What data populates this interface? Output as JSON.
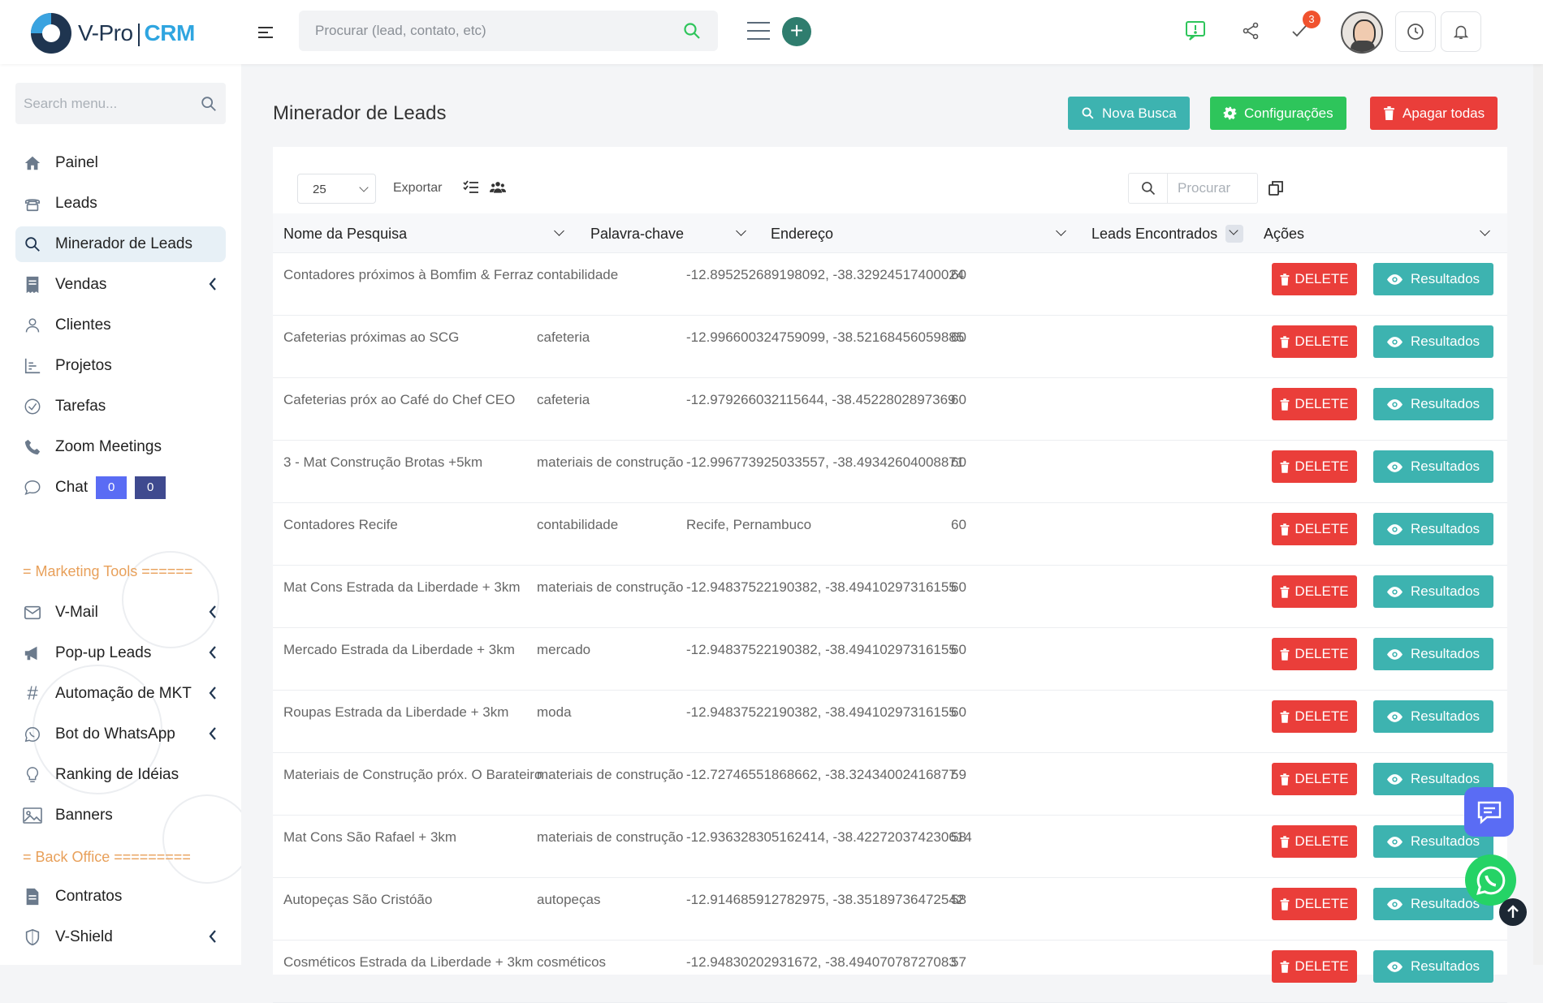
{
  "app": {
    "logo_primary": "V-Pro",
    "logo_secondary": "CRM",
    "notification_count": "3"
  },
  "colors": {
    "accent_teal": "#3db3b0",
    "success_green": "#2ec55b",
    "danger_red": "#ea3e3a",
    "brand_dark": "#1f3550"
  },
  "header": {
    "search_placeholder": "Procurar (lead, contato, etc)",
    "icons": [
      "menu-toggle-icon",
      "search-icon",
      "list-icon",
      "plus-icon",
      "feedback-icon",
      "share-icon",
      "check-icon",
      "avatar",
      "clock-icon",
      "bell-icon"
    ]
  },
  "sidebar": {
    "search_placeholder": "Search menu...",
    "items": [
      {
        "label": "Painel",
        "icon": "home-icon"
      },
      {
        "label": "Leads",
        "icon": "phone-desk-icon"
      },
      {
        "label": "Minerador de Leads",
        "icon": "search-icon",
        "active": true
      },
      {
        "label": "Vendas",
        "icon": "receipt-icon"
      },
      {
        "label": "Clientes",
        "icon": "user-icon"
      },
      {
        "label": "Projetos",
        "icon": "chart-icon"
      },
      {
        "label": "Tarefas",
        "icon": "check-circle-icon"
      },
      {
        "label": "Zoom Meetings",
        "icon": "phone-icon"
      },
      {
        "label": "Chat",
        "icon": "chat-bubble-icon"
      }
    ],
    "chat_badges": [
      "0",
      "0"
    ],
    "section_marketing": "= Marketing Tools ======",
    "marketing_items": [
      {
        "label": "V-Mail",
        "icon": "mail-icon"
      },
      {
        "label": "Pop-up Leads",
        "icon": "megaphone-icon"
      },
      {
        "label": "Automação de MKT",
        "icon": "hash-icon"
      },
      {
        "label": "Bot do WhatsApp",
        "icon": "whatsapp-icon"
      },
      {
        "label": "Ranking de Idéias",
        "icon": "lightbulb-icon"
      },
      {
        "label": "Banners",
        "icon": "image-icon"
      }
    ],
    "section_backoffice": "= Back Office =========",
    "backoffice_items": [
      {
        "label": "Contratos",
        "icon": "document-icon"
      },
      {
        "label": "V-Shield",
        "icon": "shield-icon"
      }
    ]
  },
  "page": {
    "title": "Minerador de Leads",
    "buttons": {
      "nova_busca": "Nova Busca",
      "configuracoes": "Configurações",
      "apagar_todas": "Apagar todas"
    },
    "toolbar": {
      "page_size": "25",
      "export": "Exportar",
      "search_placeholder": "Procurar"
    },
    "columns": [
      "Nome da Pesquisa",
      "Palavra-chave",
      "Endereço",
      "Leads Encontrados",
      "Ações"
    ],
    "action_labels": {
      "delete": "DELETE",
      "results": "Resultados"
    },
    "rows": [
      {
        "nome": "Contadores próximos à Bomfim & Ferraz",
        "palavra": "contabilidade",
        "endereco": "-12.895252689198092, -38.32924517400024",
        "leads": "60"
      },
      {
        "nome": "Cafeterias próximas ao SCG",
        "palavra": "cafeteria",
        "endereco": "-12.996600324759099, -38.52168456059885",
        "leads": "60"
      },
      {
        "nome": "Cafeterias próx ao Café do Chef CEO",
        "palavra": "cafeteria",
        "endereco": "-12.979266032115644, -38.4522802897369",
        "leads": "60"
      },
      {
        "nome": "3 - Mat Construção Brotas +5km",
        "palavra": "materiais de construção",
        "endereco": "-12.996773925033557, -38.49342604008871",
        "leads": "60"
      },
      {
        "nome": "Contadores Recife",
        "palavra": "contabilidade",
        "endereco": "Recife, Pernambuco",
        "leads": "60"
      },
      {
        "nome": "Mat Cons Estrada da Liberdade + 3km",
        "palavra": "materiais de construção",
        "endereco": "-12.94837522190382, -38.49410297316155",
        "leads": "60"
      },
      {
        "nome": "Mercado Estrada da Liberdade + 3km",
        "palavra": "mercado",
        "endereco": "-12.94837522190382, -38.49410297316155",
        "leads": "60"
      },
      {
        "nome": "Roupas Estrada da Liberdade + 3km",
        "palavra": "moda",
        "endereco": "-12.94837522190382, -38.49410297316155",
        "leads": "60"
      },
      {
        "nome": "Materiais de Construção próx. O Barateiro",
        "palavra": "materiais de construção",
        "endereco": "-12.72746551868662, -38.32434002416877",
        "leads": "59"
      },
      {
        "nome": "Mat Cons São Rafael + 3km",
        "palavra": "materiais de construção",
        "endereco": "-12.936328305162414, -38.422720374230614",
        "leads": "58"
      },
      {
        "nome": "Autopeças São Cristóão",
        "palavra": "autopeças",
        "endereco": "-12.914685912782975, -38.35189736472542",
        "leads": "58"
      },
      {
        "nome": "Cosméticos Estrada da Liberdade + 3km",
        "palavra": "cosméticos",
        "endereco": "-12.94830202931672, -38.49407078727083",
        "leads": "57"
      }
    ]
  }
}
